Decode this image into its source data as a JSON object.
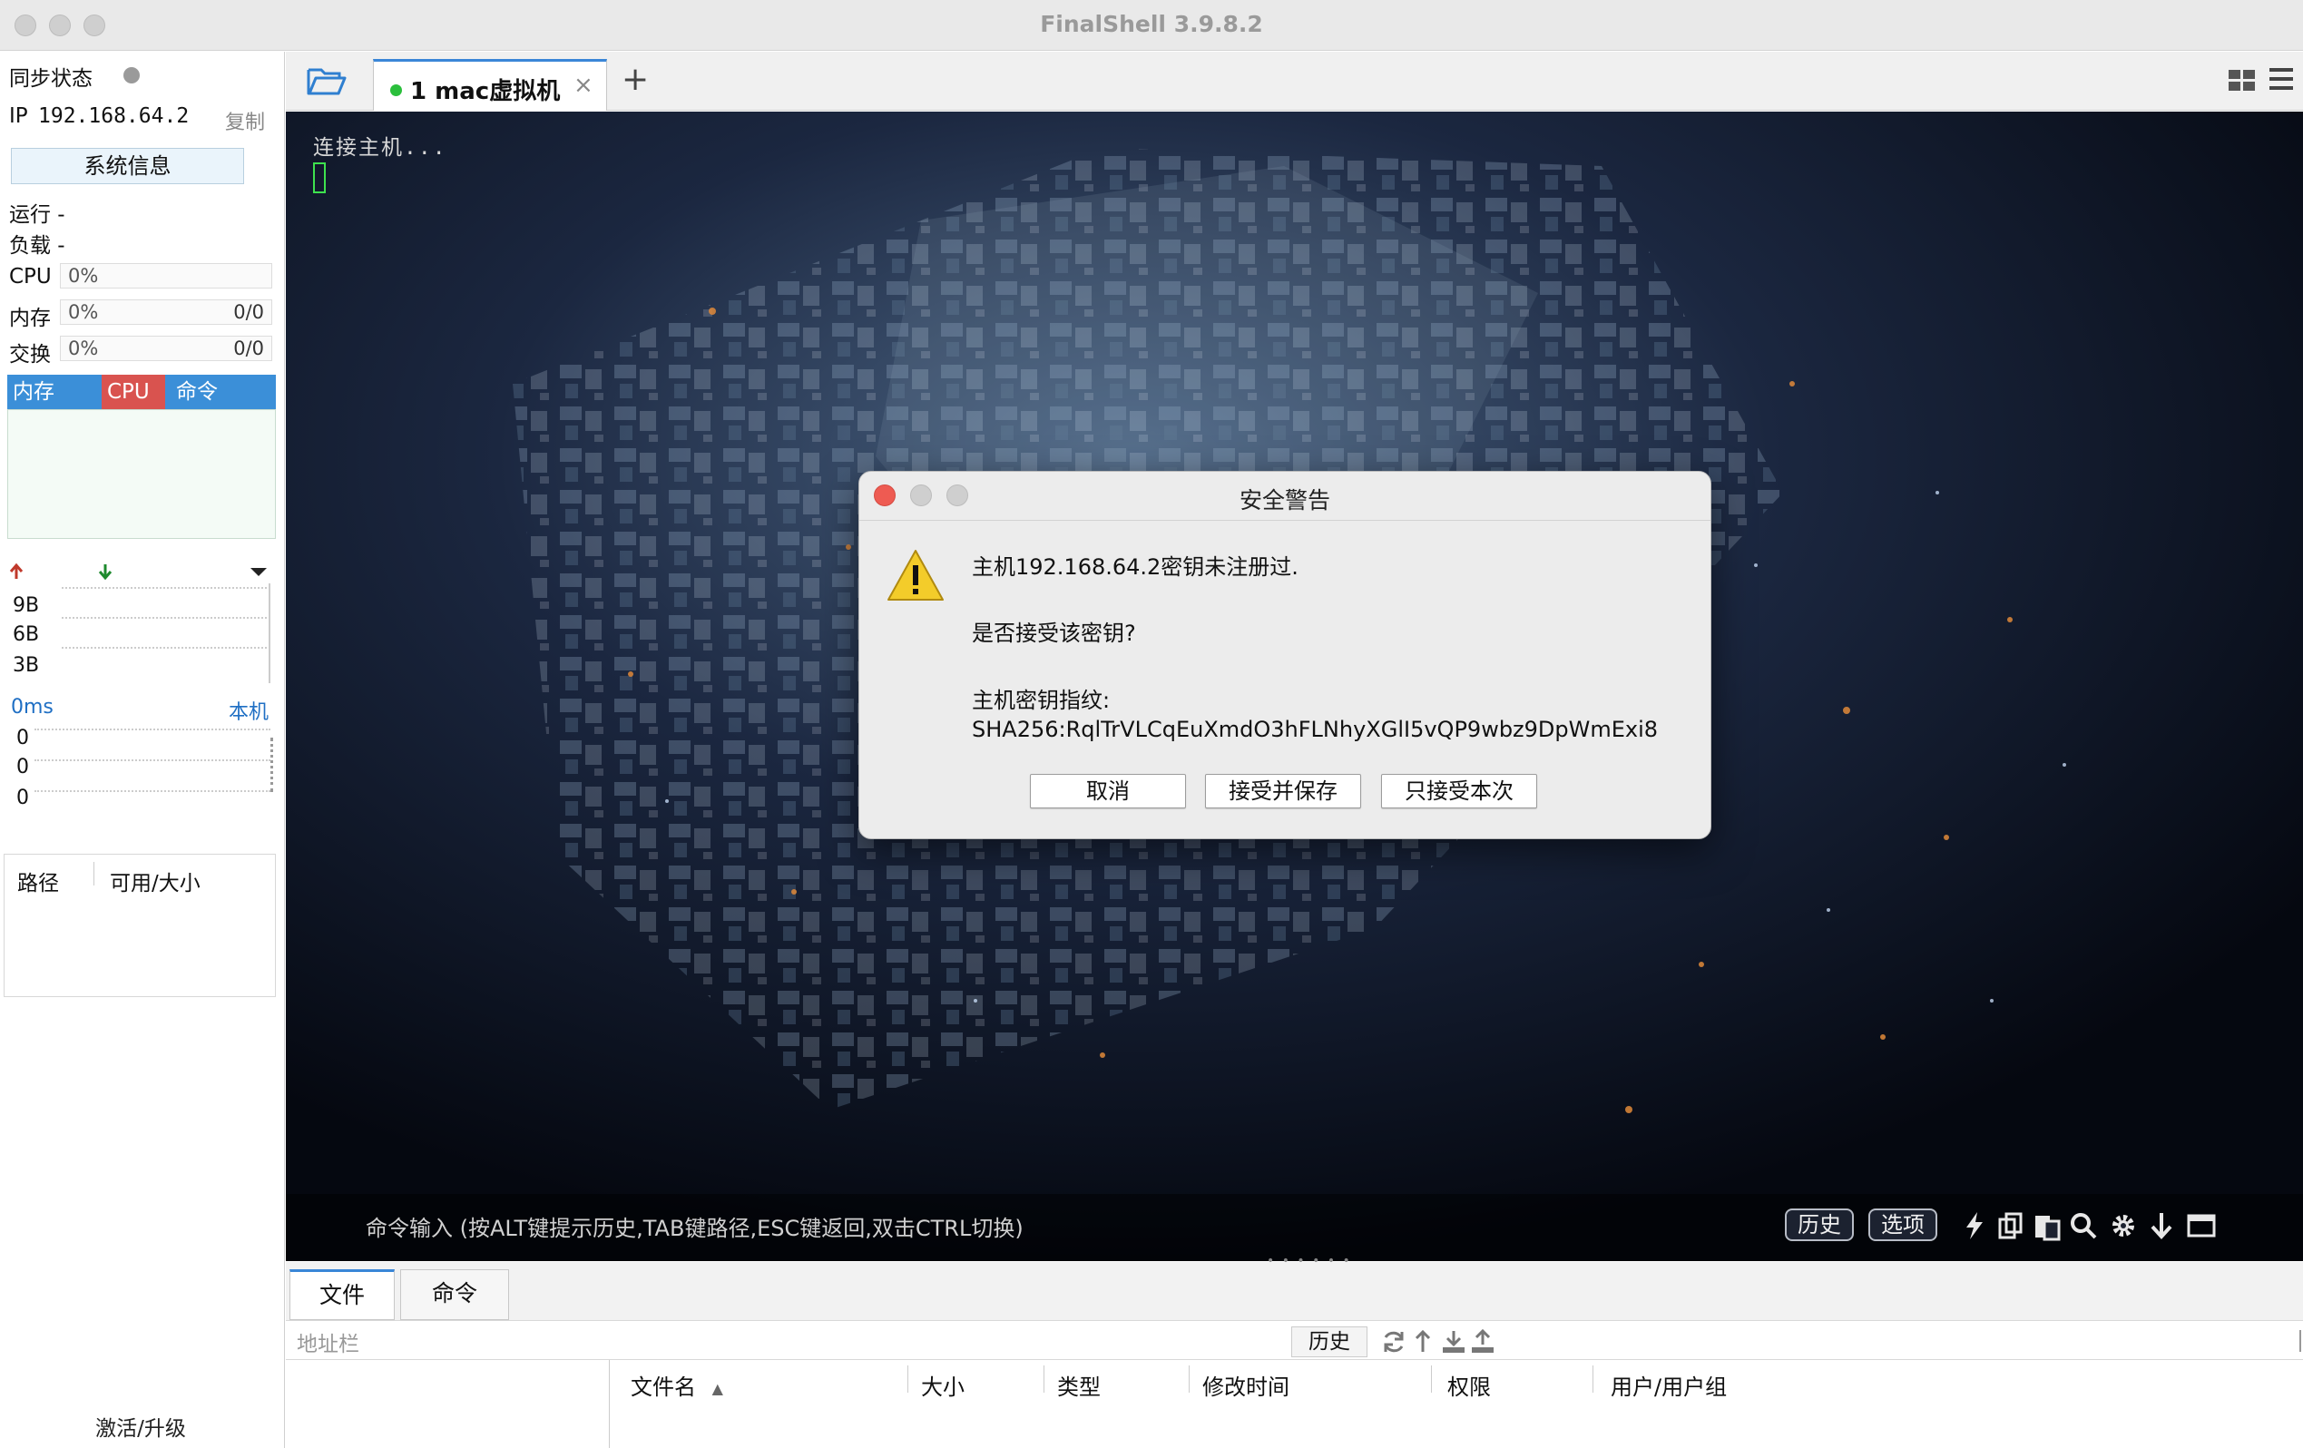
{
  "window": {
    "title": "FinalShell 3.9.8.2"
  },
  "left_panel": {
    "sync_label": "同步状态",
    "ip_label": "IP",
    "ip_value": "192.168.64.2",
    "copy_label": "复制",
    "sysinfo_button": "系统信息",
    "run_label": "运行 -",
    "load_label": "负载 -",
    "cpu": {
      "label": "CPU",
      "percent": "0%"
    },
    "mem": {
      "label": "内存",
      "percent": "0%",
      "amount": "0/0"
    },
    "swap": {
      "label": "交换",
      "percent": "0%",
      "amount": "0/0"
    },
    "proc_tabs": [
      "内存",
      "CPU",
      "命令"
    ],
    "net_labels": [
      "9B",
      "6B",
      "3B"
    ],
    "ping_label": "0ms",
    "ping_target": "本机",
    "ping_values": [
      "0",
      "0",
      "0"
    ],
    "disk_headers": [
      "路径",
      "可用/大小"
    ],
    "activate_label": "激活/升级"
  },
  "tabs": {
    "connection": {
      "label": "1  mac虚拟机",
      "status": "connected",
      "status_color": "#2bbf3c"
    }
  },
  "terminal": {
    "output": "连接主机...",
    "command_hint": "命令输入 (按ALT键提示历史,TAB键路径,ESC键返回,双击CTRL切换)",
    "history_button": "历史",
    "options_button": "选项"
  },
  "dialog": {
    "title": "安全警告",
    "line1": "主机192.168.64.2密钥未注册过.",
    "line2": "是否接受该密钥?",
    "line3": "主机密钥指纹:",
    "line4": "SHA256:RqlTrVLCqEuXmdO3hFLNhyXGlI5vQP9wbz9DpWmExi8",
    "buttons": {
      "cancel": "取消",
      "accept_save": "接受并保存",
      "accept_once": "只接受本次"
    }
  },
  "bottom_panel": {
    "tabs": [
      "文件",
      "命令"
    ],
    "address_placeholder": "地址栏",
    "history_button": "历史",
    "columns": [
      "文件名",
      "大小",
      "类型",
      "修改时间",
      "权限",
      "用户/用户组"
    ]
  },
  "colors": {
    "accent": "#3a86d7",
    "proc_header": "#3b8fd8",
    "cpu_tab": "#d9534f"
  }
}
